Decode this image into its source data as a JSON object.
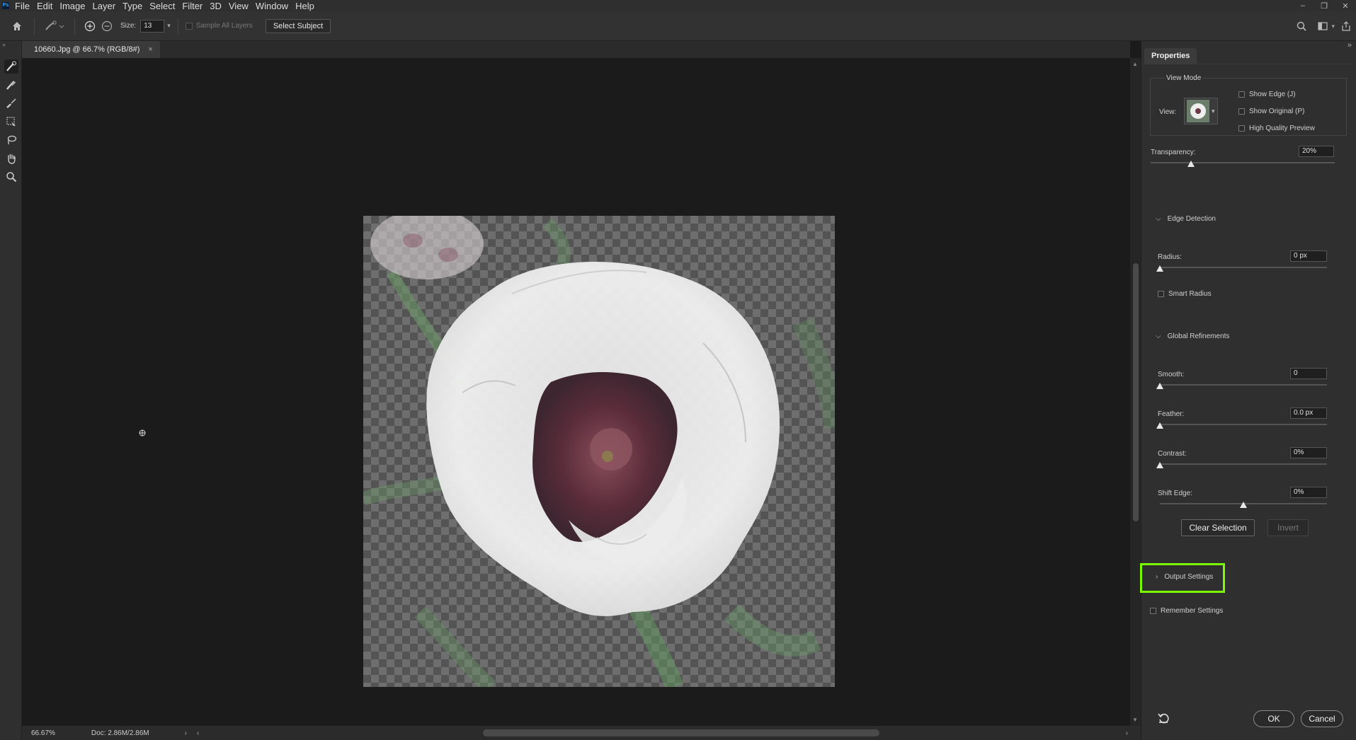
{
  "app": {
    "logo": "Ps"
  },
  "menu": [
    "File",
    "Edit",
    "Image",
    "Layer",
    "Type",
    "Select",
    "Filter",
    "3D",
    "View",
    "Window",
    "Help"
  ],
  "window_controls": {
    "minimize": "–",
    "restore": "❐",
    "close": "✕"
  },
  "options": {
    "size_label": "Size:",
    "size_value": "13",
    "sample_all_layers": "Sample All Layers",
    "select_subject": "Select Subject"
  },
  "document": {
    "tab_title": "10660.Jpg @ 66.7% (RGB/8#)",
    "close": "×"
  },
  "status": {
    "zoom": "66.67%",
    "doc": "Doc: 2.86M/2.86M"
  },
  "properties": {
    "tab": "Properties",
    "view_mode": {
      "title": "View Mode",
      "view_label": "View:",
      "show_edge": "Show Edge (J)",
      "show_original": "Show Original (P)",
      "high_quality": "High Quality Preview"
    },
    "transparency": {
      "label": "Transparency:",
      "value": "20%",
      "fraction": 0.2
    },
    "edge_detection": {
      "title": "Edge Detection",
      "radius_label": "Radius:",
      "radius_value": "0 px",
      "smart_radius": "Smart Radius"
    },
    "global_refinements": {
      "title": "Global Refinements",
      "smooth_label": "Smooth:",
      "smooth_value": "0",
      "feather_label": "Feather:",
      "feather_value": "0.0 px",
      "contrast_label": "Contrast:",
      "contrast_value": "0%",
      "shift_label": "Shift Edge:",
      "shift_value": "0%"
    },
    "clear_selection": "Clear Selection",
    "invert": "Invert",
    "output_settings": "Output Settings",
    "remember_settings": "Remember Settings",
    "ok": "OK",
    "cancel": "Cancel"
  },
  "colors": {
    "highlight": "#7cfc00",
    "panel": "#2f2f2f",
    "canvas": "#1b1b1b"
  }
}
